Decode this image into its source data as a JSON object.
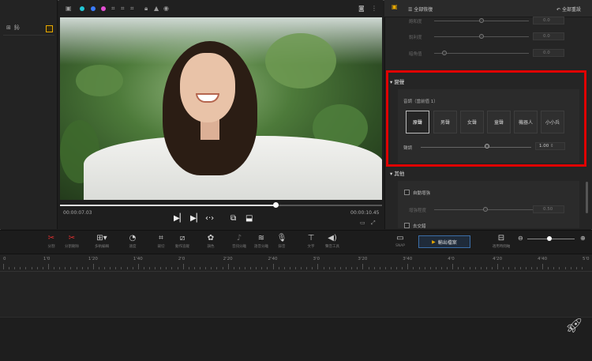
{
  "colors": {
    "accent": "#e8a800",
    "highlight": "#e00000",
    "export": "#3b6ea8"
  },
  "left_panel": {
    "tabs": [
      "⊞",
      "鈊"
    ]
  },
  "preview": {
    "current_time": "00:00:07.03",
    "total_time": "00:00:10.45",
    "progress": 0.67,
    "toolbar_icons": [
      "image-icon",
      "color-dot-cyan",
      "color-dot-blue",
      "color-dot-pink",
      "crop-icon",
      "crop-icon",
      "crop-icon",
      "lock-icon",
      "mountain-icon",
      "eye-icon"
    ],
    "controls": [
      "play-prev-icon",
      "play-icon",
      "split-arrows-icon",
      "fullscreen-icon",
      "save-frame-icon"
    ]
  },
  "right_panel": {
    "header_left": "全部恢復",
    "header_right": "全部重設",
    "faded_rows": [
      {
        "label": "飽和度",
        "value": "0.0"
      },
      {
        "label": "銳利度",
        "value": "0.0"
      },
      {
        "label": "暗角值",
        "value": "0.0"
      }
    ],
    "voice_section": {
      "title": "變聲",
      "pitch_label": "音調（當前值 1）",
      "options": [
        "原聲",
        "男聲",
        "女聲",
        "童聲",
        "機器人",
        "小小兵"
      ],
      "selected_index": 0,
      "volume_label": "聲調",
      "volume_value": "1.00",
      "volume_level": 0.6
    },
    "other_section": {
      "title": "其他",
      "auto_enhance": "自動增強",
      "enhance_label": "增強程度",
      "enhance_value": "0.50",
      "reverse": "去交錯"
    }
  },
  "toolbar": {
    "tools": [
      {
        "icon": "scissors-icon",
        "label": "分割"
      },
      {
        "icon": "split-delete-icon",
        "label": "分割刪除"
      },
      {
        "icon": "layout-icon",
        "label": "多軌編輯"
      },
      {
        "icon": "speed-icon",
        "label": "速度"
      },
      {
        "icon": "crop-icon",
        "label": "裁切"
      },
      {
        "icon": "motion-icon",
        "label": "動作追蹤"
      },
      {
        "icon": "palette-icon",
        "label": "調色"
      },
      {
        "icon": "audio-split-icon",
        "label": "音訊分離"
      },
      {
        "icon": "audio-denoise-icon",
        "label": "語音分離"
      },
      {
        "icon": "mic-icon",
        "label": "錄音"
      },
      {
        "icon": "text-icon",
        "label": "文字"
      },
      {
        "icon": "sound-icon",
        "label": "聲音工具"
      }
    ],
    "snapshot_label": "SNAP",
    "export_label": "輸出檔案",
    "fit_label": "適用時間軸"
  },
  "timeline": {
    "ticks": [
      "0",
      "1'0",
      "1'20",
      "1'40",
      "2'0",
      "2'20",
      "2'40",
      "3'0",
      "3'20",
      "3'40",
      "4'0",
      "4'20",
      "4'40",
      "5'0"
    ]
  }
}
